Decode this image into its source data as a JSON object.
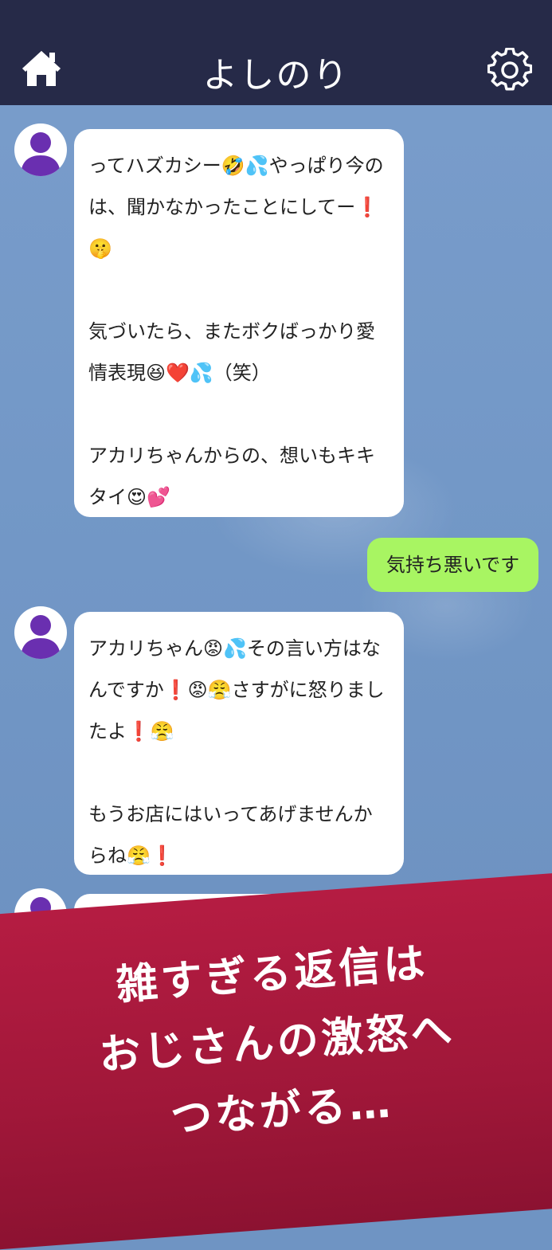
{
  "header": {
    "title": "よしのり",
    "home_icon": "home-icon",
    "settings_icon": "gear-icon",
    "background": "#262a48"
  },
  "messages": [
    {
      "side": "left",
      "text": "ってハズカシー🤣💦やっぱり今のは、聞かなかったことにしてー❗🤫\n\n気づいたら、またボクばっかり愛情表現😆❤️💦（笑）\n\nアカリちゃんからの、想いもキキタイ😍💕"
    },
    {
      "side": "right",
      "text": "気持ち悪いです"
    },
    {
      "side": "left",
      "text": "アカリちゃん😡💦その言い方はなんですか❗😡😤さすがに怒りましたよ❗😤\n\nもうお店にはいってあげませんからね😤❗"
    },
    {
      "side": "left",
      "text": ""
    }
  ],
  "banner": {
    "lines": [
      "雑すぎる返信は",
      "おじさんの激怒へ",
      "つながる…"
    ],
    "color": "#a8193d"
  },
  "colors": {
    "outgoing_bubble": "#a8f562",
    "incoming_bubble": "#ffffff",
    "avatar_silhouette": "#6a2fb0"
  }
}
